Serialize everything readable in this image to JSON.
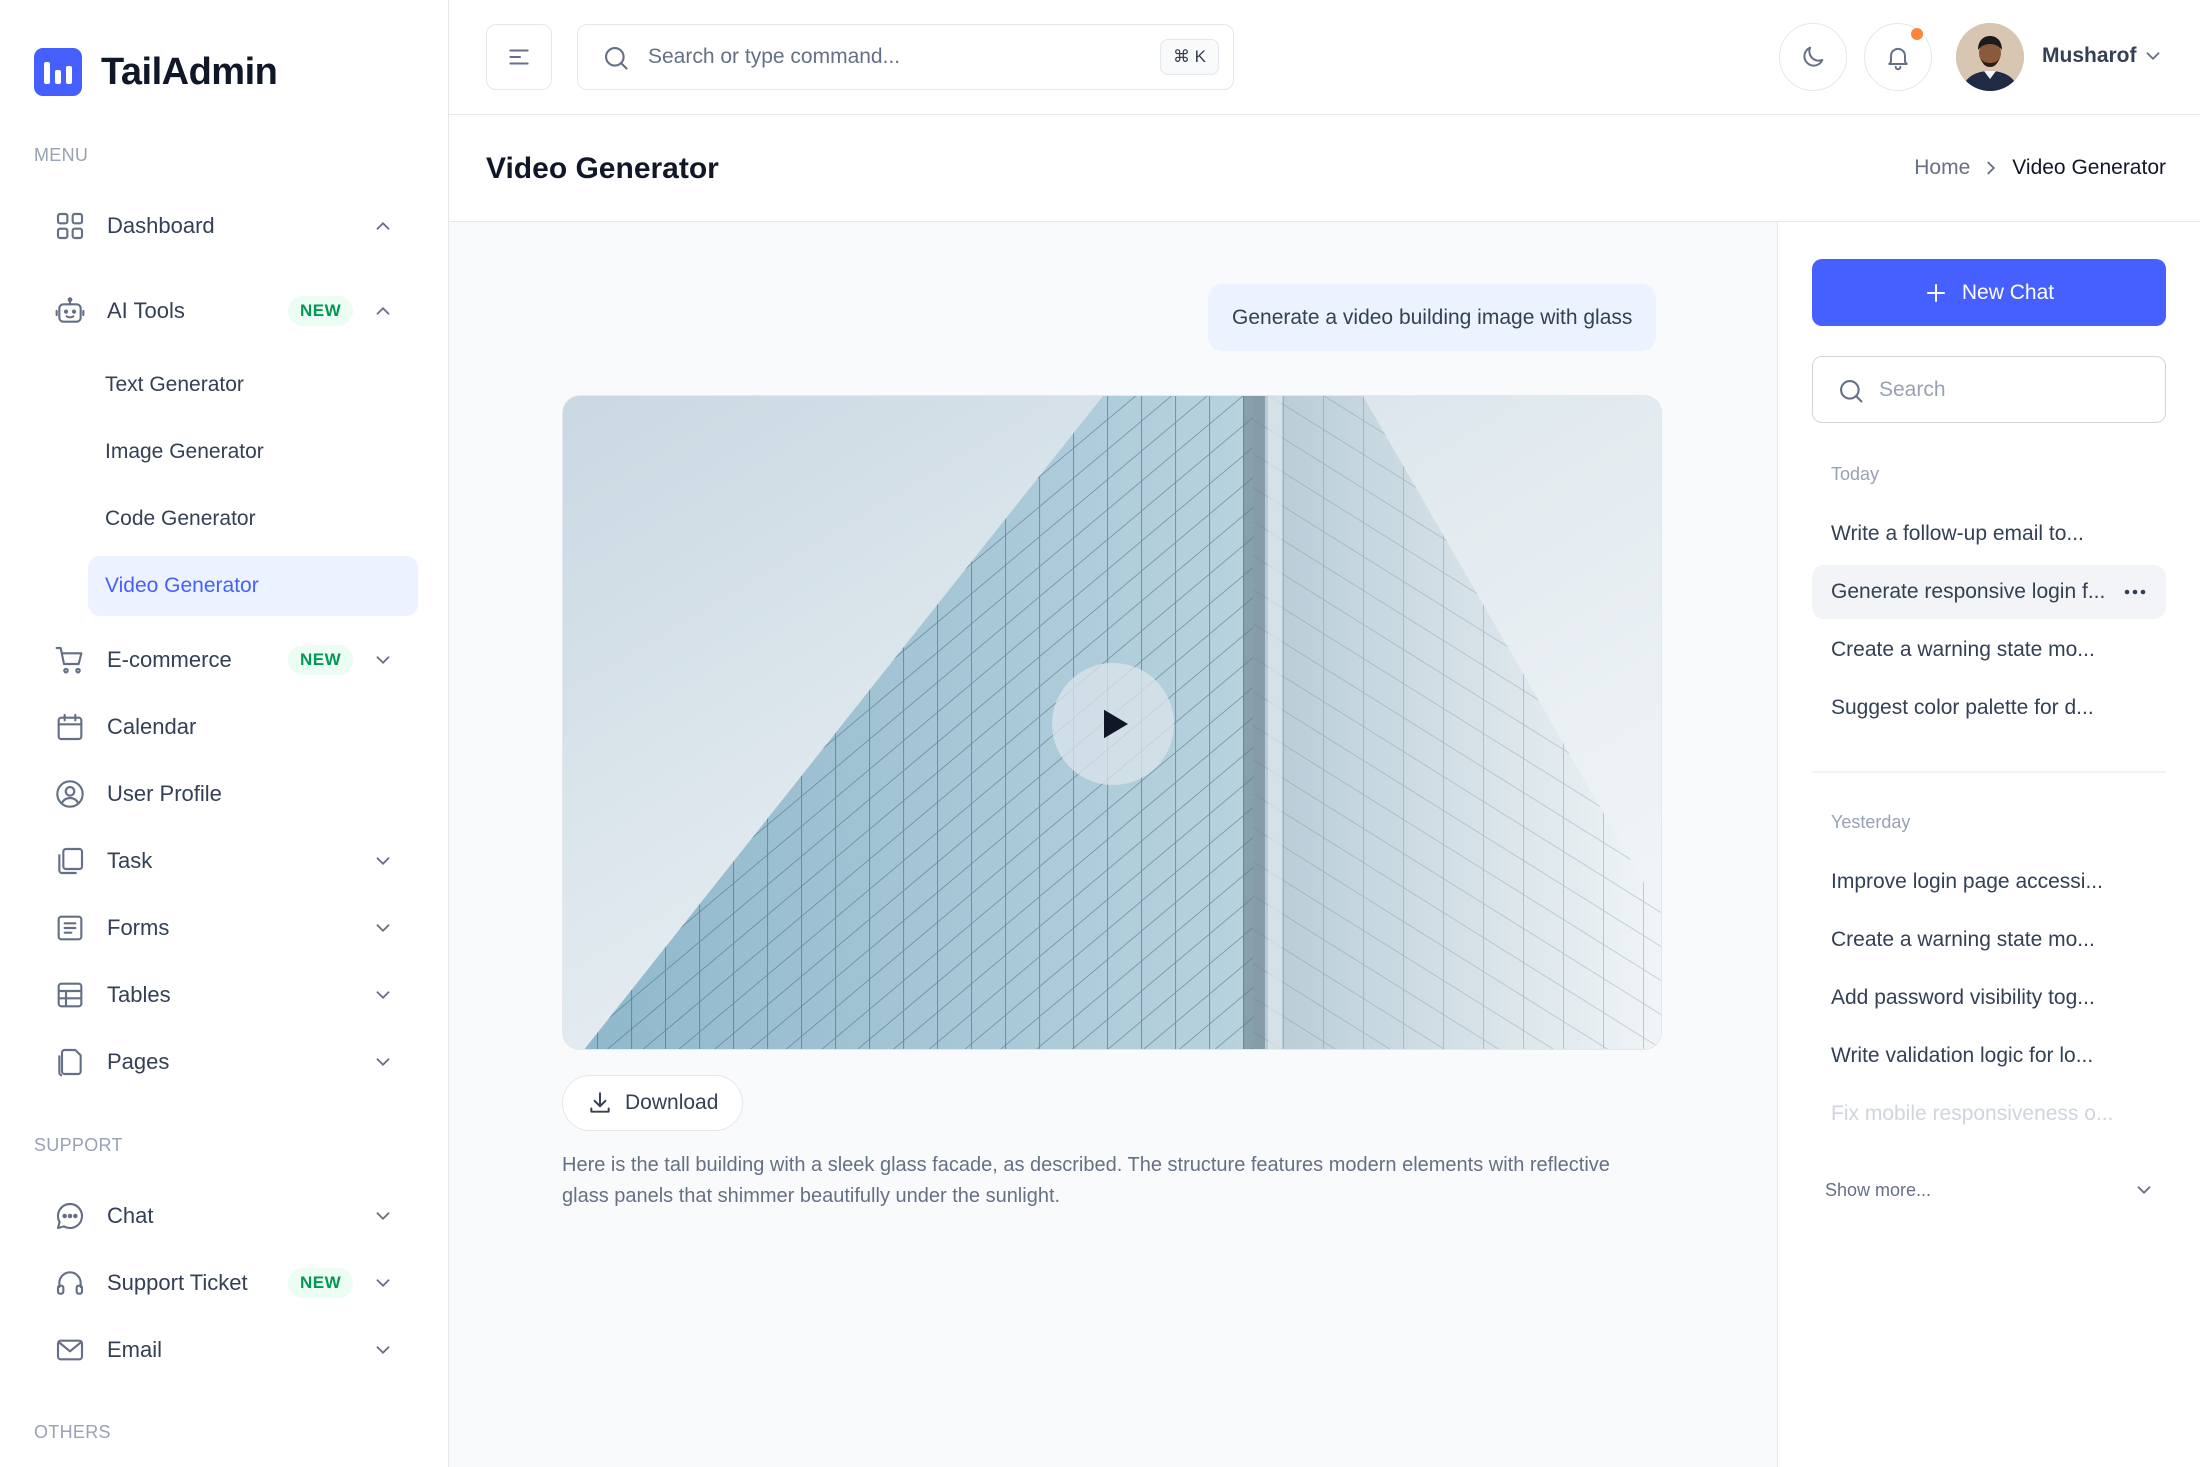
{
  "brand": {
    "name": "TailAdmin",
    "accent": "#465fff"
  },
  "sidebar": {
    "menu_label": "MENU",
    "support_label": "SUPPORT",
    "others_label": "OTHERS",
    "menu_items": [
      {
        "label": "Dashboard",
        "icon": "grid-icon",
        "chevron": "up"
      },
      {
        "label": "AI Tools",
        "icon": "robot-icon",
        "badge": "NEW",
        "chevron": "up"
      },
      {
        "label": "E-commerce",
        "icon": "cart-icon",
        "badge": "NEW",
        "chevron": "down"
      },
      {
        "label": "Calendar",
        "icon": "calendar-icon"
      },
      {
        "label": "User Profile",
        "icon": "user-circle-icon"
      },
      {
        "label": "Task",
        "icon": "task-icon",
        "chevron": "down"
      },
      {
        "label": "Forms",
        "icon": "forms-icon",
        "chevron": "down"
      },
      {
        "label": "Tables",
        "icon": "table-icon",
        "chevron": "down"
      },
      {
        "label": "Pages",
        "icon": "pages-icon",
        "chevron": "down"
      }
    ],
    "ai_sub_items": [
      {
        "label": "Text Generator"
      },
      {
        "label": "Image Generator"
      },
      {
        "label": "Code Generator"
      },
      {
        "label": "Video Generator",
        "active": true
      }
    ],
    "support_items": [
      {
        "label": "Chat",
        "icon": "chat-icon",
        "chevron": "down"
      },
      {
        "label": "Support Ticket",
        "icon": "headset-icon",
        "badge": "NEW",
        "chevron": "down"
      },
      {
        "label": "Email",
        "icon": "mail-icon",
        "chevron": "down"
      }
    ]
  },
  "header": {
    "search_placeholder": "Search or type command...",
    "shortcut": "⌘ K",
    "user_name": "Musharof"
  },
  "page": {
    "title": "Video Generator",
    "breadcrumb_home": "Home",
    "breadcrumb_current": "Video Generator"
  },
  "chat": {
    "prompt": "Generate a video building image with glass",
    "download_label": "Download",
    "description": "Here is the tall building with a sleek glass facade, as described. The structure features modern elements with reflective glass panels that shimmer beautifully under the sunlight."
  },
  "history": {
    "new_chat_label": "New Chat",
    "search_placeholder": "Search",
    "today_label": "Today",
    "today": [
      "Write a follow-up email to...",
      "Generate responsive login f...",
      "Create a warning state mo...",
      "Suggest color palette for d..."
    ],
    "yesterday_label": "Yesterday",
    "yesterday": [
      "Improve login page accessi...",
      "Create a warning state mo...",
      "Add password visibility tog...",
      "Write validation logic for lo...",
      "Fix mobile responsiveness o..."
    ],
    "show_more_label": "Show more..."
  }
}
